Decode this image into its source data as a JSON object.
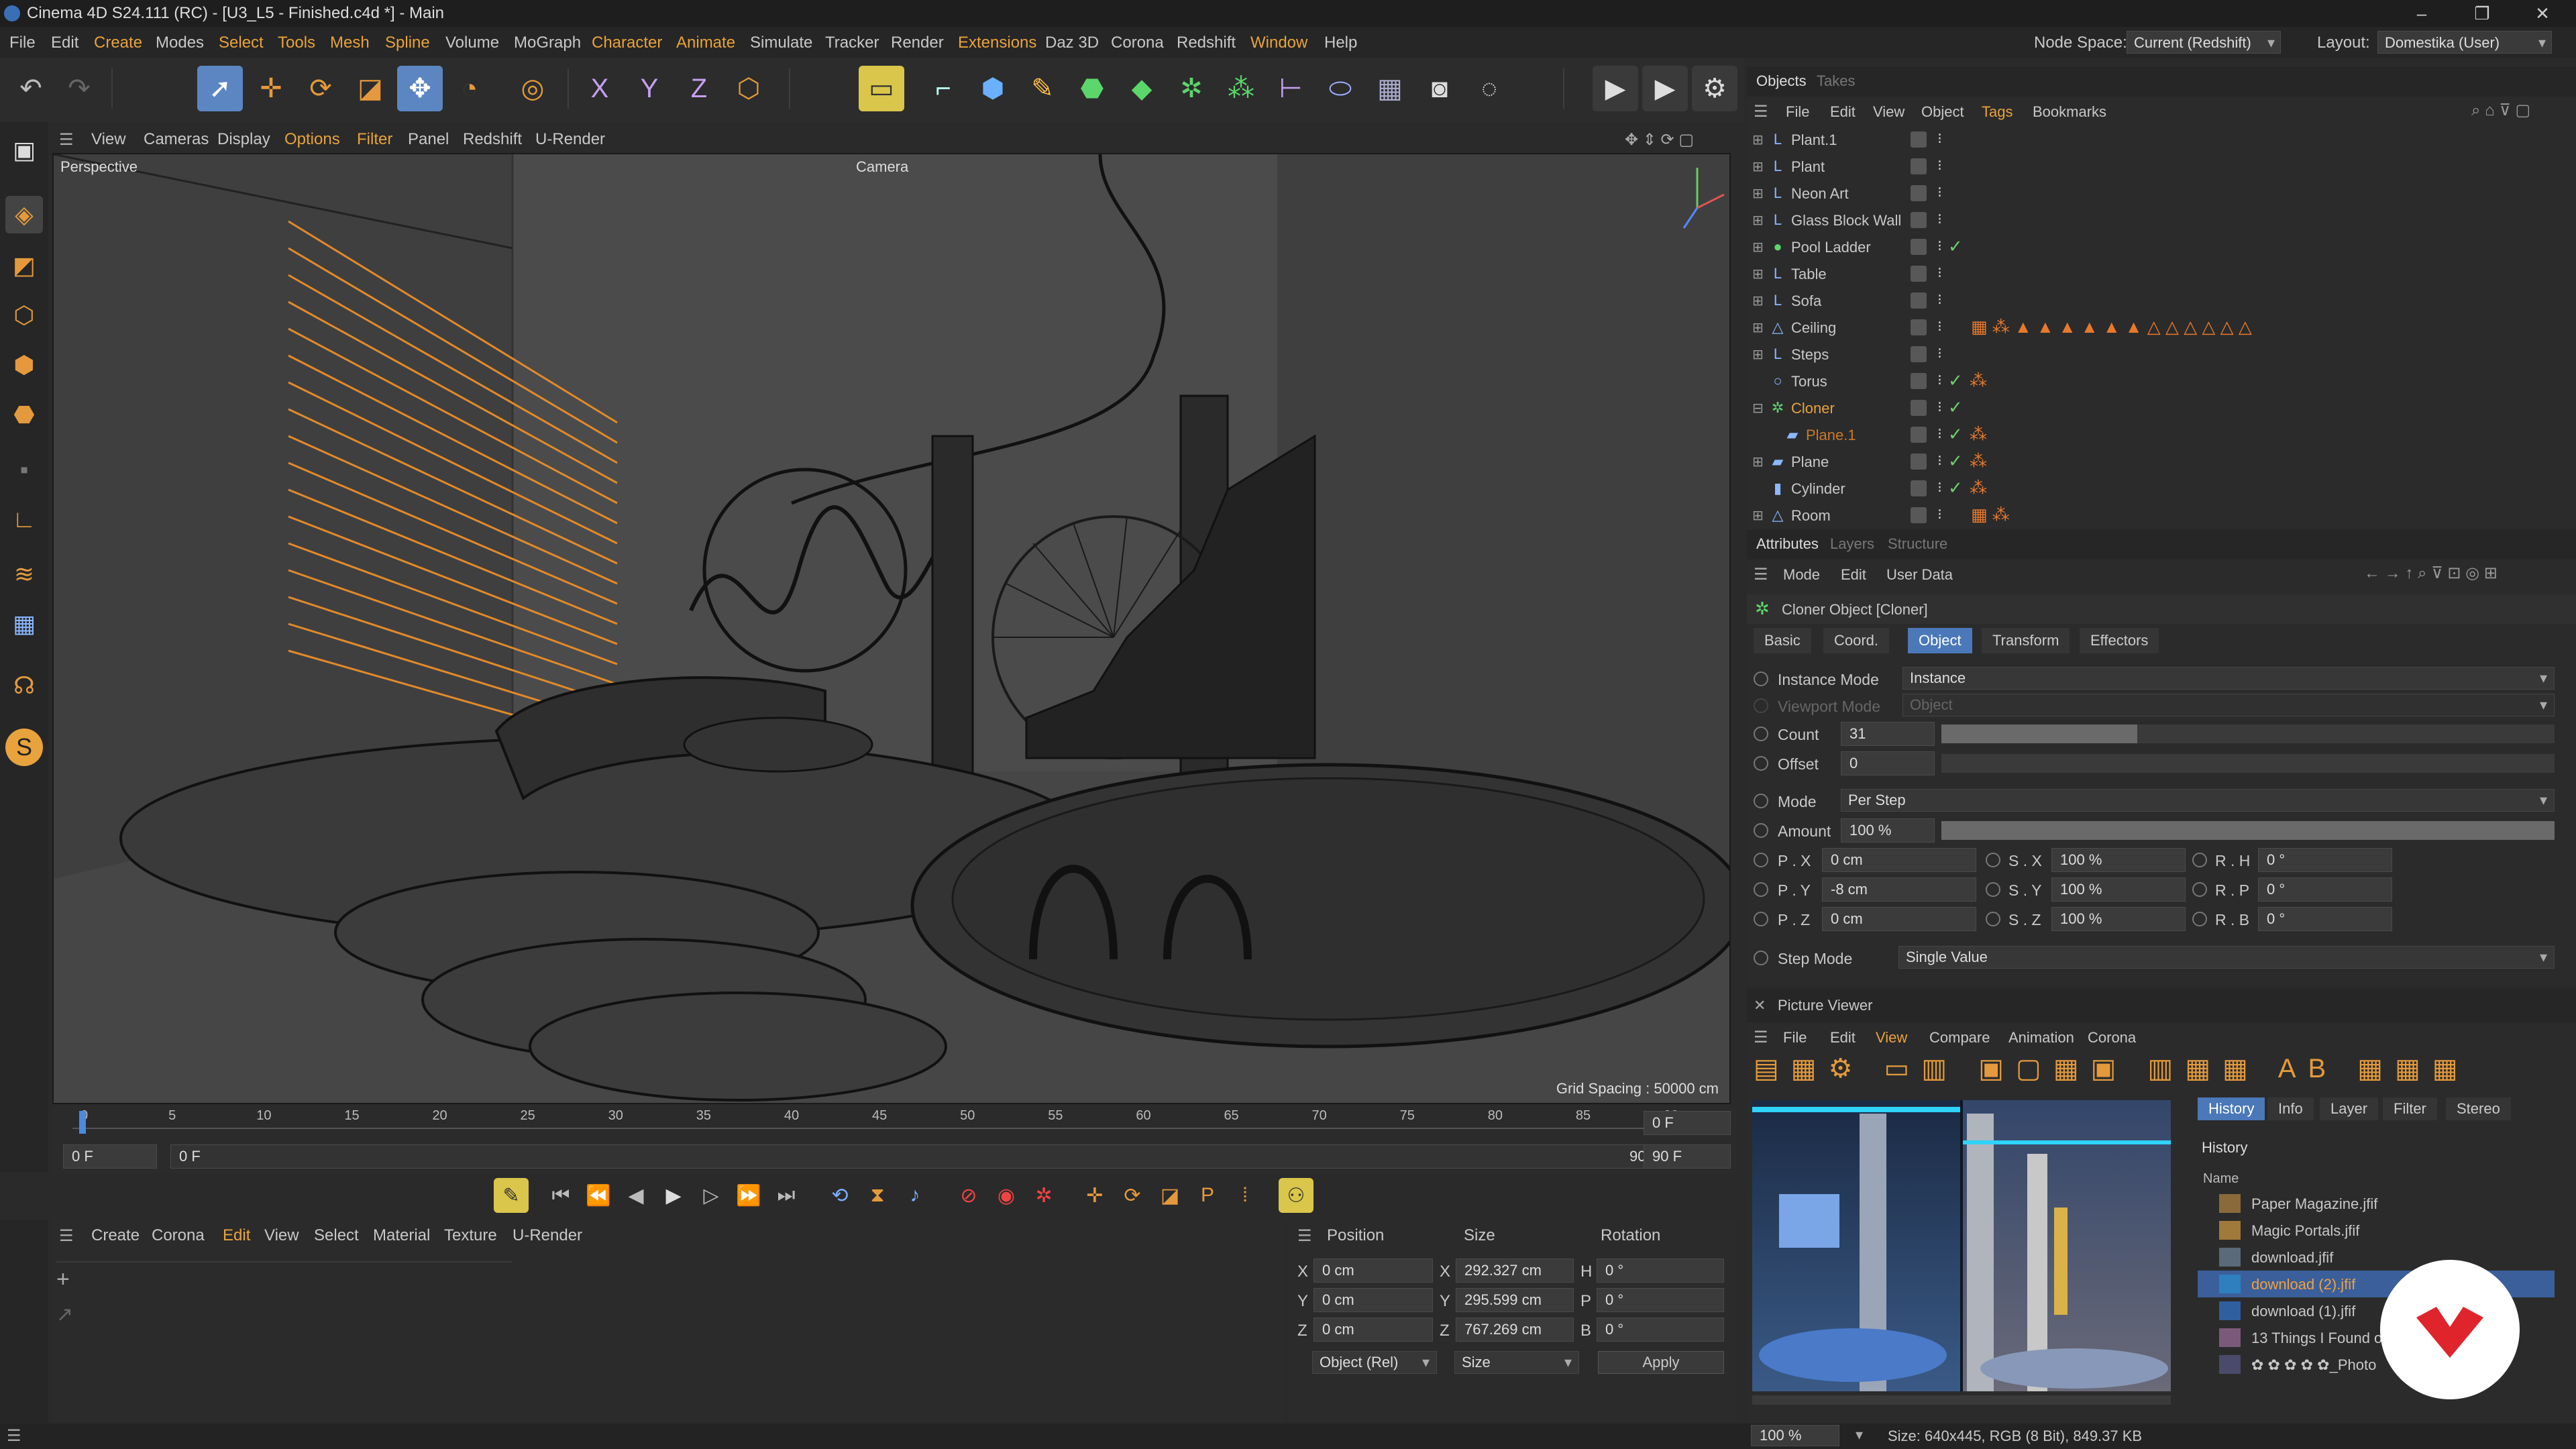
{
  "window": {
    "title": "Cinema 4D S24.111 (RC) - [U3_L5 - Finished.c4d *] - Main"
  },
  "menubar": {
    "items": [
      "File",
      "Edit",
      "Create",
      "Modes",
      "Select",
      "Tools",
      "Mesh",
      "Spline",
      "Volume",
      "MoGraph",
      "Character",
      "Animate",
      "Simulate",
      "Tracker",
      "Render",
      "Extensions",
      "Daz 3D",
      "Corona",
      "Redshift",
      "Window",
      "Help"
    ],
    "node_space_label": "Node Space:",
    "node_space_value": "Current (Redshift)",
    "layout_label": "Layout:",
    "layout_value": "Domestika (User)"
  },
  "viewport_menu": {
    "items": [
      "View",
      "Cameras",
      "Display",
      "Options",
      "Filter",
      "Panel",
      "Redshift",
      "U-Render"
    ]
  },
  "viewport": {
    "label": "Perspective",
    "camera": "Camera",
    "grid_spacing": "Grid Spacing : 50000 cm"
  },
  "timeline": {
    "ticks": [
      "0",
      "5",
      "10",
      "15",
      "20",
      "25",
      "30",
      "35",
      "40",
      "45",
      "50",
      "55",
      "60",
      "65",
      "70",
      "75",
      "80",
      "85",
      "90"
    ],
    "current_frame": "0 F",
    "start_field": "0 F",
    "range_start": "0 F",
    "range_end": "90 F",
    "end_field": "90 F",
    "end_field2": "90 F"
  },
  "material_menu": {
    "items": [
      "Create",
      "Corona",
      "Edit",
      "View",
      "Select",
      "Material",
      "Texture",
      "U-Render"
    ]
  },
  "coordinates": {
    "headers": {
      "position": "Position",
      "size": "Size",
      "rotation": "Rotation"
    },
    "rows": [
      {
        "axis": "X",
        "pos": "0 cm",
        "saxis": "X",
        "size": "292.327 cm",
        "raxis": "H",
        "rot": "0 °"
      },
      {
        "axis": "Y",
        "pos": "0 cm",
        "saxis": "Y",
        "size": "295.599 cm",
        "raxis": "P",
        "rot": "0 °"
      },
      {
        "axis": "Z",
        "pos": "0 cm",
        "saxis": "Z",
        "size": "767.269 cm",
        "raxis": "B",
        "rot": "0 °"
      }
    ],
    "mode": "Object (Rel)",
    "size_mode": "Size",
    "apply": "Apply"
  },
  "objects_panel": {
    "tabs": [
      "Objects",
      "Takes"
    ],
    "menu": [
      "File",
      "Edit",
      "View",
      "Object",
      "Tags",
      "Bookmarks"
    ],
    "items": [
      {
        "name": "Plant.1",
        "icon": "L",
        "check": false
      },
      {
        "name": "Plant",
        "icon": "L",
        "check": false
      },
      {
        "name": "Neon Art",
        "icon": "L",
        "check": false
      },
      {
        "name": "Glass Block Wall",
        "icon": "L",
        "check": false
      },
      {
        "name": "Pool Ladder",
        "icon": "●",
        "check": true
      },
      {
        "name": "Table",
        "icon": "L",
        "check": false
      },
      {
        "name": "Sofa",
        "icon": "L",
        "check": false
      },
      {
        "name": "Ceiling",
        "icon": "△",
        "check": false
      },
      {
        "name": "Steps",
        "icon": "L",
        "check": false
      },
      {
        "name": "Torus",
        "icon": "○",
        "check": true
      },
      {
        "name": "Cloner",
        "icon": "✲",
        "check": true
      },
      {
        "name": "Plane.1",
        "icon": "▰",
        "check": true
      },
      {
        "name": "Plane",
        "icon": "▰",
        "check": true
      },
      {
        "name": "Cylinder",
        "icon": "▮",
        "check": true
      },
      {
        "name": "Room",
        "icon": "△",
        "check": false
      }
    ]
  },
  "attributes_panel": {
    "tabs": [
      "Attributes",
      "Layers",
      "Structure"
    ],
    "menu": [
      "Mode",
      "Edit",
      "User Data"
    ],
    "object_title": "Cloner Object [Cloner]",
    "subtabs": [
      "Basic",
      "Coord.",
      "Object",
      "Transform",
      "Effectors"
    ],
    "instance_mode_label": "Instance Mode",
    "instance_mode_value": "Instance",
    "viewport_mode_label": "Viewport Mode",
    "viewport_mode_value": "Object",
    "count_label": "Count",
    "count_value": "31",
    "offset_label": "Offset",
    "offset_value": "0",
    "mode_label": "Mode",
    "mode_value": "Per Step",
    "amount_label": "Amount",
    "amount_value": "100 %",
    "transform_rows": [
      {
        "p_label": "P . X",
        "p_val": "0 cm",
        "s_label": "S . X",
        "s_val": "100 %",
        "r_label": "R . H",
        "r_val": "0 °"
      },
      {
        "p_label": "P . Y",
        "p_val": "-8 cm",
        "s_label": "S . Y",
        "s_val": "100 %",
        "r_label": "R . P",
        "r_val": "0 °"
      },
      {
        "p_label": "P . Z",
        "p_val": "0 cm",
        "s_label": "S . Z",
        "s_val": "100 %",
        "r_label": "R . B",
        "r_val": "0 °"
      }
    ],
    "step_mode_label": "Step Mode",
    "step_mode_value": "Single Value"
  },
  "picture_viewer": {
    "title": "Picture Viewer",
    "menu": [
      "File",
      "Edit",
      "View",
      "Compare",
      "Animation",
      "Corona"
    ],
    "side_tabs": [
      "History",
      "Info",
      "Layer",
      "Filter",
      "Stereo"
    ],
    "history_title": "History",
    "name_header": "Name",
    "history": [
      "Paper Magazine.jfif",
      "Magic Portals.jfif",
      "download.jfif",
      "download (2).jfif",
      "download (1).jfif",
      "13 Things I Found o",
      "✿ ✿ ✿ ✿ ✿_Photo"
    ],
    "selected_index": 3,
    "zoom": "100 %",
    "size_info": "Size: 640x445, RGB (8 Bit), 849.37 KB"
  }
}
